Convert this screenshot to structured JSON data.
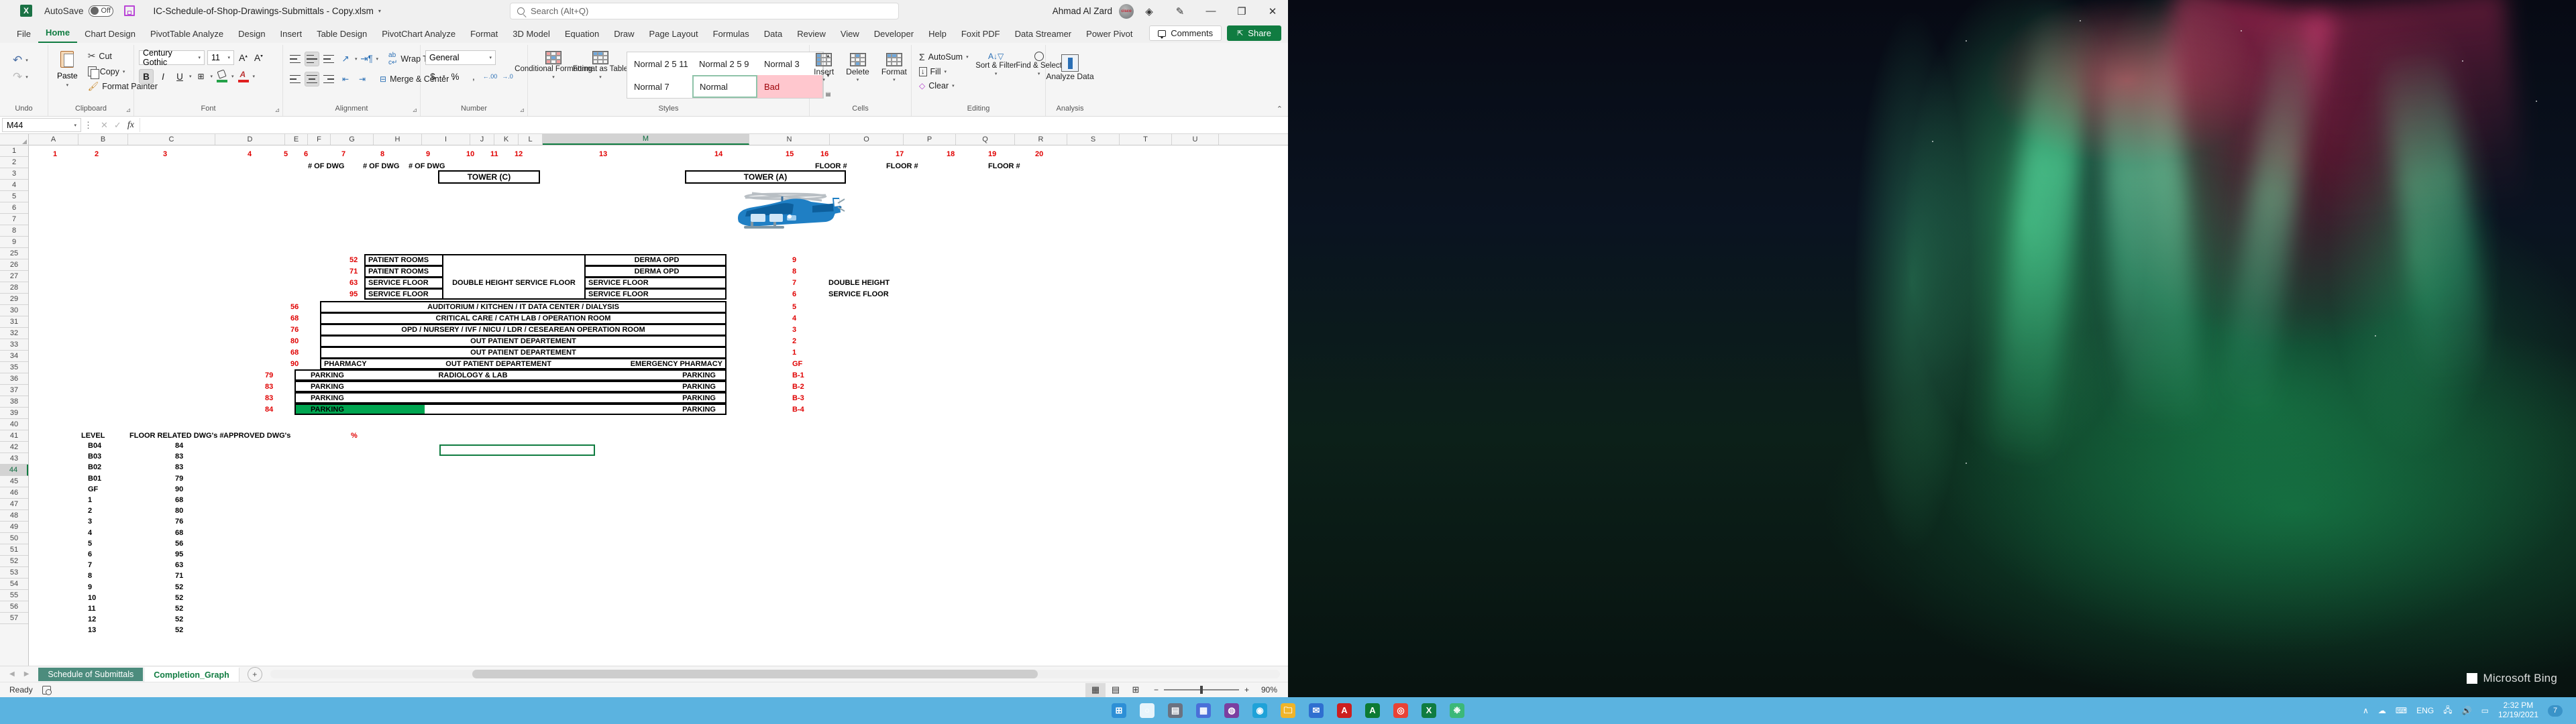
{
  "titlebar": {
    "app_icon": "excel-logo-icon",
    "autosave_label": "AutoSave",
    "autosave_state": "Off",
    "save_icon": "save-icon",
    "document_title": "IC-Schedule-of-Shop-Drawings-Submittals - Copy.xlsm",
    "title_caret": "▾",
    "user_name": "Ahmad Al Zard",
    "minimize": "—",
    "restore": "❐",
    "close": "✕"
  },
  "search": {
    "placeholder": "Search (Alt+Q)",
    "icon": "search-icon"
  },
  "ribbon": {
    "tabs": [
      "File",
      "Home",
      "Chart Design",
      "PivotTable Analyze",
      "Design",
      "Insert",
      "Table Design",
      "PivotChart Analyze",
      "Format",
      "3D Model",
      "Equation",
      "Draw",
      "Page Layout",
      "Formulas",
      "Data",
      "Review",
      "View",
      "Developer",
      "Help",
      "Foxit PDF",
      "Data Streamer",
      "Power Pivot"
    ],
    "active_tab": "Home",
    "comments_label": "Comments",
    "share_label": "Share",
    "collapse_icon": "chevron-up-icon",
    "groups": {
      "undo": {
        "label": "Undo",
        "undo": "Undo",
        "redo": "Redo"
      },
      "clipboard": {
        "label": "Clipboard",
        "paste": "Paste",
        "cut": "Cut",
        "copy": "Copy",
        "format_painter": "Format Painter"
      },
      "font": {
        "label": "Font",
        "font_name": "Century Gothic",
        "font_size": "11",
        "grow": "A",
        "shrink": "A",
        "bold": "B",
        "italic": "I",
        "underline": "U",
        "borders": "Borders",
        "fill_color": "Fill Color",
        "font_color": "Font Color"
      },
      "alignment": {
        "label": "Alignment",
        "wrap_text": "Wrap Text",
        "merge_center": "Merge & Center",
        "orientation": "Orientation",
        "indent": "Indent"
      },
      "number": {
        "label": "Number",
        "format": "General",
        "currency": "$",
        "percent": "%",
        "comma": " ,",
        "inc_dec": ".00",
        "dec_dec": ".00"
      },
      "styles": {
        "label": "Styles",
        "conditional_formatting": "Conditional Formatting",
        "format_as_table": "Format as Table",
        "gallery": [
          "Normal 2 5 11",
          "Normal 2 5 9",
          "Normal 3",
          "Normal 7",
          "Normal",
          "Bad"
        ],
        "selected_style": "Normal"
      },
      "cells": {
        "label": "Cells",
        "insert": "Insert",
        "delete": "Delete",
        "format": "Format"
      },
      "editing": {
        "label": "Editing",
        "autosum": "AutoSum",
        "fill": "Fill",
        "clear": "Clear",
        "sort_filter": "Sort & Filter",
        "find_select": "Find & Select"
      },
      "analysis": {
        "label": "Analysis",
        "analyze_data": "Analyze Data"
      }
    }
  },
  "formula_bar": {
    "name_box": "M44",
    "cancel": "✕",
    "enter": "✓",
    "fx": "fx",
    "value": ""
  },
  "grid": {
    "columns": [
      "A",
      "B",
      "C",
      "D",
      "E",
      "F",
      "G",
      "H",
      "I",
      "J",
      "K",
      "L",
      "M",
      "N",
      "O",
      "P",
      "Q",
      "R",
      "S",
      "T",
      "U"
    ],
    "selected_column": "M",
    "rows": [
      "1",
      "2",
      "3",
      "4",
      "5",
      "6",
      "7",
      "8",
      "9",
      "25",
      "26",
      "27",
      "28",
      "29",
      "30",
      "31",
      "32",
      "33",
      "34",
      "35",
      "36",
      "37",
      "38",
      "39",
      "40",
      "41",
      "42",
      "43",
      "44",
      "45",
      "46",
      "47",
      "48",
      "49",
      "50",
      "51",
      "52",
      "53",
      "54",
      "55",
      "56",
      "57"
    ],
    "selected_row": "44",
    "row1_numbers": [
      "1",
      "2",
      "3",
      "4",
      "5",
      "6",
      "7",
      "8",
      "9",
      "10",
      "11",
      "12",
      "13",
      "14",
      "15",
      "16",
      "17",
      "18",
      "19",
      "20"
    ],
    "dwg_headers": [
      "# OF DWG",
      "# OF DWG",
      "# OF DWG"
    ],
    "floor_headers": [
      "FLOOR #",
      "FLOOR #",
      "FLOOR #"
    ],
    "tower_c": "TOWER (C)",
    "tower_a": "TOWER (A)",
    "helicopter_icon": "helicopter-image"
  },
  "building": {
    "upper_floors": [
      {
        "count": "52",
        "left": "PATIENT ROOMS",
        "middle": "",
        "right": "DERMA OPD",
        "floor": "9",
        "note": ""
      },
      {
        "count": "71",
        "left": "PATIENT ROOMS",
        "middle": "",
        "right": "DERMA OPD",
        "floor": "8",
        "note": ""
      },
      {
        "count": "63",
        "left": "SERVICE FLOOR",
        "middle": "DOUBLE HEIGHT SERVICE FLOOR",
        "right": "SERVICE FLOOR",
        "floor": "7",
        "note": "DOUBLE HEIGHT"
      },
      {
        "count": "95",
        "left": "SERVICE FLOOR",
        "middle": "",
        "right": "SERVICE FLOOR",
        "floor": "6",
        "note": "SERVICE FLOOR"
      }
    ],
    "wide_floors": [
      {
        "count": "56",
        "label": "AUDITORIUM / KITCHEN / IT DATA CENTER / DIALYSIS",
        "floor": "5"
      },
      {
        "count": "68",
        "label": "CRITICAL CARE / CATH LAB / OPERATION ROOM",
        "floor": "4"
      },
      {
        "count": "76",
        "label": "OPD / NURSERY / IVF / NICU / LDR / CESEAREAN OPERATION ROOM",
        "floor": "3"
      },
      {
        "count": "80",
        "label": "OUT PATIENT DEPARTEMENT",
        "floor": "2"
      },
      {
        "count": "68",
        "label": "OUT PATIENT DEPARTEMENT",
        "floor": "1"
      }
    ],
    "ground_floor": {
      "count": "90",
      "left": "PHARMACY",
      "middle": "OUT PATIENT DEPARTEMENT",
      "right": "EMERGENCY  PHARMACY",
      "floor": "GF"
    },
    "basements": [
      {
        "count": "79",
        "left": "PARKING",
        "middle": "RADIOLOGY & LAB",
        "right": "PARKING",
        "floor": "B-1",
        "progress": 0
      },
      {
        "count": "83",
        "left": "PARKING",
        "middle": "",
        "right": "PARKING",
        "floor": "B-2",
        "progress": 0
      },
      {
        "count": "83",
        "left": "PARKING",
        "middle": "",
        "right": "PARKING",
        "floor": "B-3",
        "progress": 0
      },
      {
        "count": "84",
        "left": "PARKING",
        "middle": "",
        "right": "PARKING",
        "floor": "B-4",
        "progress": 30
      }
    ],
    "progress_color": "#00a550"
  },
  "level_table": {
    "headers": [
      "LEVEL",
      "FLOOR RELATED DWG's #",
      "APPROVED DWG's",
      "%"
    ],
    "rows": [
      {
        "level": "B04",
        "related": "84",
        "approved": "",
        "percent": ""
      },
      {
        "level": "B03",
        "related": "83",
        "approved": "",
        "percent": ""
      },
      {
        "level": "B02",
        "related": "83",
        "approved": "",
        "percent": ""
      },
      {
        "level": "B01",
        "related": "79",
        "approved": "",
        "percent": ""
      },
      {
        "level": "GF",
        "related": "90",
        "approved": "",
        "percent": ""
      },
      {
        "level": "1",
        "related": "68",
        "approved": "",
        "percent": ""
      },
      {
        "level": "2",
        "related": "80",
        "approved": "",
        "percent": ""
      },
      {
        "level": "3",
        "related": "76",
        "approved": "",
        "percent": ""
      },
      {
        "level": "4",
        "related": "68",
        "approved": "",
        "percent": ""
      },
      {
        "level": "5",
        "related": "56",
        "approved": "",
        "percent": ""
      },
      {
        "level": "6",
        "related": "95",
        "approved": "",
        "percent": ""
      },
      {
        "level": "7",
        "related": "63",
        "approved": "",
        "percent": ""
      },
      {
        "level": "8",
        "related": "71",
        "approved": "",
        "percent": ""
      },
      {
        "level": "9",
        "related": "52",
        "approved": "",
        "percent": ""
      },
      {
        "level": "10",
        "related": "52",
        "approved": "",
        "percent": ""
      },
      {
        "level": "11",
        "related": "52",
        "approved": "",
        "percent": ""
      },
      {
        "level": "12",
        "related": "52",
        "approved": "",
        "percent": ""
      },
      {
        "level": "13",
        "related": "52",
        "approved": "",
        "percent": ""
      }
    ]
  },
  "sheet_tabs": {
    "prev_arrow": "◀",
    "next_arrow": "▶",
    "tabs": [
      "Schedule of Submittals",
      "Completion_Graph"
    ],
    "active": "Completion_Graph",
    "add_label": "+"
  },
  "status_bar": {
    "state": "Ready",
    "macro_icon": "record-macro-icon",
    "views": [
      "normal-view-icon",
      "page-layout-icon",
      "page-break-icon"
    ],
    "active_view": "normal-view-icon",
    "zoom_out": "−",
    "zoom_in": "+",
    "zoom_level": "90%"
  },
  "taskbar": {
    "pinned": [
      {
        "name": "start-icon",
        "glyph": "⊞",
        "color": "#2d8fd6"
      },
      {
        "name": "search-icon",
        "glyph": "○",
        "color": "#e8f4fb"
      },
      {
        "name": "widgets-icon",
        "glyph": "▤",
        "color": "#6b7280"
      },
      {
        "name": "teams-icon",
        "glyph": "▦",
        "color": "#4a6fd8"
      },
      {
        "name": "office-icon",
        "glyph": "◍",
        "color": "#7b3fa0"
      },
      {
        "name": "edge-icon",
        "glyph": "◉",
        "color": "#1fa2d8"
      },
      {
        "name": "file-explorer-icon",
        "glyph": "🗀",
        "color": "#f0b429"
      },
      {
        "name": "mail-icon",
        "glyph": "✉",
        "color": "#2f6fd0"
      },
      {
        "name": "adobe-icon",
        "glyph": "A",
        "color": "#cc1f1f"
      },
      {
        "name": "autocad-icon",
        "glyph": "A",
        "color": "#0d7a34"
      },
      {
        "name": "chrome-icon",
        "glyph": "◎",
        "color": "#e94235"
      },
      {
        "name": "excel-icon",
        "glyph": "X",
        "color": "#107c41"
      },
      {
        "name": "photos-icon",
        "glyph": "❉",
        "color": "#3cb878"
      }
    ],
    "system": {
      "chevron": "∧",
      "onedrive": "☁",
      "keyboard": "⌨",
      "language": "ENG",
      "network": "🖧",
      "volume": "🔊",
      "battery": "▭",
      "time": "2:32 PM",
      "date": "12/19/2021",
      "notifications": "7"
    }
  },
  "desktop": {
    "watermark": "Microsoft Bing"
  }
}
